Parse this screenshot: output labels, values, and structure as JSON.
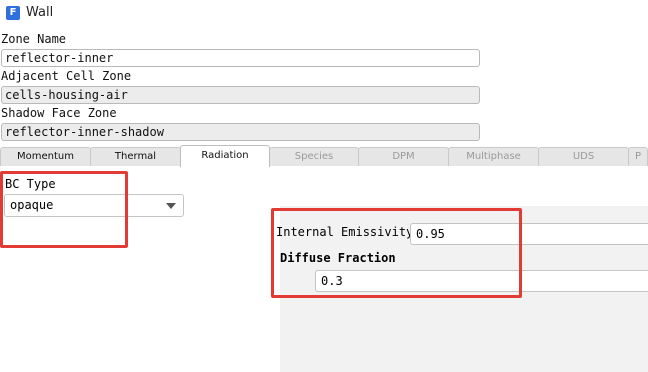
{
  "window": {
    "title": "Wall",
    "icon_letter": "F",
    "icon_color": "#2f6fde"
  },
  "form": {
    "zone_name_label": "Zone Name",
    "zone_name_value": "reflector-inner",
    "adjacent_label": "Adjacent Cell Zone",
    "adjacent_value": "cells-housing-air",
    "shadow_label": "Shadow Face Zone",
    "shadow_value": "reflector-inner-shadow"
  },
  "tabs": [
    {
      "label": "Momentum",
      "state": "enabled"
    },
    {
      "label": "Thermal",
      "state": "enabled"
    },
    {
      "label": "Radiation",
      "state": "active"
    },
    {
      "label": "Species",
      "state": "disabled"
    },
    {
      "label": "DPM",
      "state": "disabled"
    },
    {
      "label": "Multiphase",
      "state": "disabled"
    },
    {
      "label": "UDS",
      "state": "disabled"
    },
    {
      "label": "P",
      "state": "disabled"
    }
  ],
  "radiation": {
    "bc_type_label": "BC Type",
    "bc_type_value": "opaque",
    "internal_emissivity_label": "Internal Emissivity",
    "internal_emissivity_value": "0.95",
    "diffuse_fraction_label": "Diffuse Fraction",
    "diffuse_fraction_value": "0.3"
  },
  "colors": {
    "annotation": "#e23b35",
    "readonly_field": "#ececec",
    "panel_gray": "#f2f2f2"
  },
  "icons": {
    "app": "fluent-app-icon",
    "dropdown": "chevron-down-icon"
  }
}
